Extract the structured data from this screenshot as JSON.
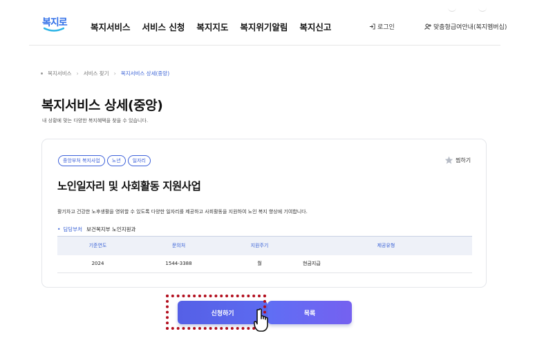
{
  "header": {
    "logo_text": "복지로",
    "nav": [
      "복지서비스",
      "서비스 신청",
      "복지지도",
      "복지위기알림",
      "복지신고"
    ],
    "login_label": "로그인",
    "member_label": "맞춤형급여안내(복지멤버십)"
  },
  "breadcrumb": [
    "복지서비스",
    "서비스 찾기",
    "복지서비스 상세(중앙)"
  ],
  "page": {
    "title": "복지서비스 상세(중앙)",
    "description": "내 상황에 맞는 다양한 복지혜택을 찾을 수 있습니다."
  },
  "service": {
    "tags": [
      "중앙부처 복지사업",
      "노년",
      "일자리"
    ],
    "bookmark_label": "찜하기",
    "title": "노인일자리 및 사회활동 지원사업",
    "description": "활기차고 건강한 노후생활을 영위할 수 있도록 다양한 일자리를 제공하고 사회활동을 지원하여 노인 복지 향상에 기여합니다.",
    "dept_label": "담당부처",
    "dept_value": "보건복지부 노인지원과",
    "table": {
      "headers": [
        "기준연도",
        "문의처",
        "지원주기",
        "제공유형"
      ],
      "row": [
        "2024",
        "1544-3388",
        "월",
        "현금지급"
      ]
    }
  },
  "buttons": {
    "apply": "신청하기",
    "list": "목록"
  },
  "colors": {
    "accent": "#3b63d6",
    "highlight": "#b20d1c"
  }
}
